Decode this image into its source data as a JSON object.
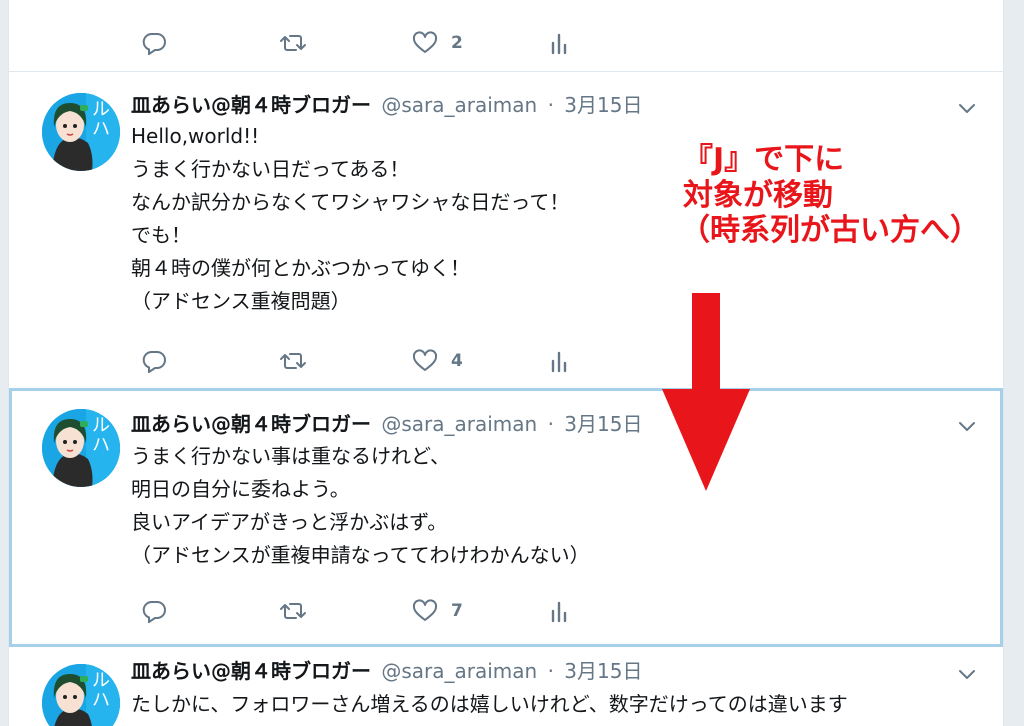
{
  "tweets": [
    {
      "stats": {
        "replies": "",
        "retweets": "",
        "likes": "2"
      }
    },
    {
      "author": {
        "name": "皿あらい@朝４時ブロガー",
        "handle": "@sara_araiman"
      },
      "separator": "·",
      "date": "3月15日",
      "lines": [
        "Hello,world!!",
        "うまく行かない日だってある！",
        "なんか訳分からなくてワシャワシャな日だって！",
        "でも！",
        "朝４時の僕が何とかぶつかってゆく！",
        "（アドセンス重複問題）"
      ],
      "stats": {
        "replies": "",
        "retweets": "",
        "likes": "4"
      }
    },
    {
      "author": {
        "name": "皿あらい@朝４時ブロガー",
        "handle": "@sara_araiman"
      },
      "separator": "·",
      "date": "3月15日",
      "selected": true,
      "lines": [
        "うまく行かない事は重なるけれど、",
        "明日の自分に委ねよう。",
        "良いアイデアがきっと浮かぶはず。",
        "（アドセンスが重複申請なっててわけわかんない）"
      ],
      "stats": {
        "replies": "",
        "retweets": "",
        "likes": "7"
      }
    },
    {
      "author": {
        "name": "皿あらい@朝４時ブロガー",
        "handle": "@sara_araiman"
      },
      "separator": "·",
      "date": "3月15日",
      "lines": [
        "たしかに、フォロワーさん増えるのは嬉しいけれど、数字だけってのは違います"
      ]
    }
  ],
  "icons": {
    "reply": "reply-icon",
    "retweet": "retweet-icon",
    "like": "heart-icon",
    "analytics": "analytics-icon",
    "caret": "chevron-down-icon",
    "avatar": "avatar"
  },
  "annotation": {
    "line1": "『J』で下に",
    "line2": "対象が移動",
    "line3": "（時系列が古い方へ）"
  },
  "colors": {
    "accent": "#1da1f2",
    "text": "#14171a",
    "secondary": "#657786",
    "selection_border": "#a6cfe9",
    "annotation": "#e8161b",
    "background": "#e6ecf0"
  }
}
